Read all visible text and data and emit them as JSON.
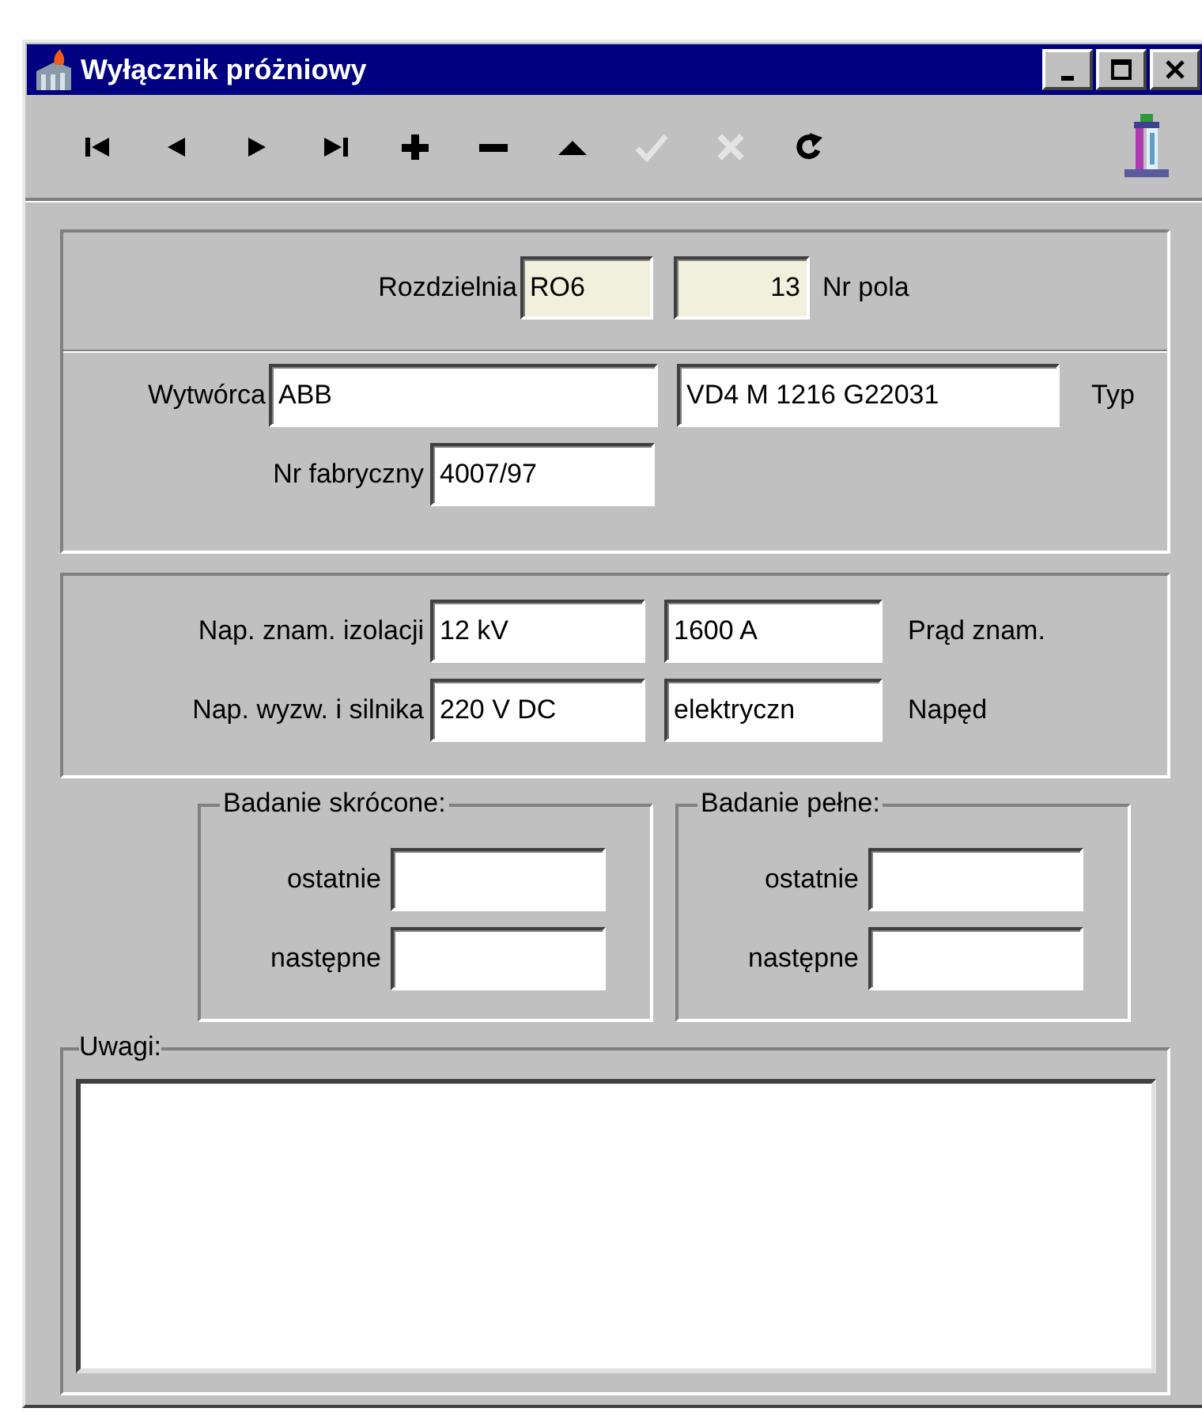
{
  "window": {
    "title": "Wyłącznik próżniowy"
  },
  "toolbar": [
    {
      "kind": "first",
      "disabled": false
    },
    {
      "kind": "prev",
      "disabled": false
    },
    {
      "kind": "next",
      "disabled": false
    },
    {
      "kind": "last",
      "disabled": false
    },
    {
      "kind": "add",
      "disabled": false
    },
    {
      "kind": "delete",
      "disabled": false
    },
    {
      "kind": "up",
      "disabled": false
    },
    {
      "kind": "confirm",
      "disabled": true
    },
    {
      "kind": "cancel",
      "disabled": true
    },
    {
      "kind": "refresh",
      "disabled": false
    }
  ],
  "location": {
    "switchgear": {
      "label": "Rozdzielnia",
      "value": "RO6",
      "readonly": true
    },
    "bay": {
      "label": "Nr pola",
      "value": "13",
      "readonly": true
    }
  },
  "device": {
    "manufacturer": {
      "label": "Wytwórca",
      "value": "ABB",
      "readonly": false
    },
    "type": {
      "label": "Typ",
      "value": "VD4 M 1216 G22031",
      "readonly": false
    },
    "serial": {
      "label": "Nr fabryczny",
      "value": "4007/97",
      "readonly": false
    }
  },
  "ratings": {
    "insulation_voltage": {
      "label": "Nap. znam. izolacji",
      "value": "12 kV",
      "readonly": false
    },
    "rated_current": {
      "label": "Prąd znam.",
      "value": "1600 A",
      "readonly": false
    },
    "trip_voltage": {
      "label": "Nap. wyzw. i silnika",
      "value": "220 V DC",
      "readonly": false
    },
    "drive": {
      "label": "Napęd",
      "value": "elektryczn",
      "readonly": false
    }
  },
  "tests": [
    {
      "title": "Badanie skrócone:",
      "rows": [
        {
          "label": "ostatnie"
        },
        {
          "label": "następne"
        }
      ]
    },
    {
      "title": "Badanie pełne:",
      "rows": [
        {
          "label": "ostatnie"
        },
        {
          "label": "następne"
        }
      ]
    }
  ],
  "notes": {
    "label": "Uwagi:"
  }
}
